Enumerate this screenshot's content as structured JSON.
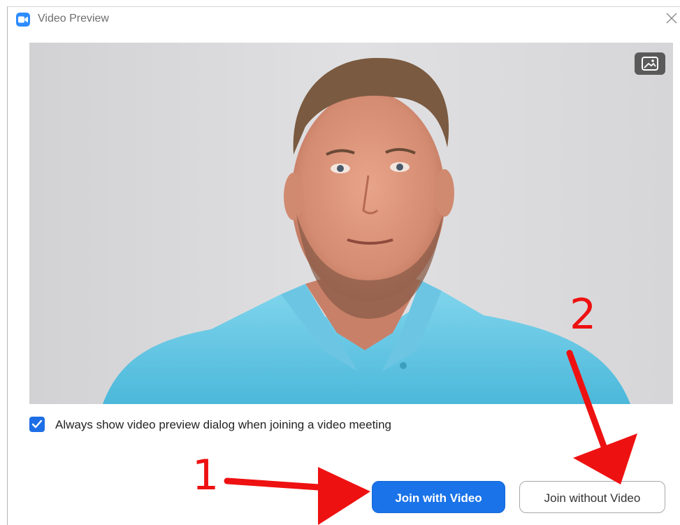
{
  "window": {
    "title": "Video Preview",
    "app_icon": "zoom-camera-icon",
    "close_icon": "close-icon"
  },
  "video": {
    "background_button_icon": "image-icon"
  },
  "options": {
    "always_show_preview": {
      "label": "Always show video preview dialog when joining a video meeting",
      "checked": true
    }
  },
  "buttons": {
    "join_with_video": "Join with Video",
    "join_without_video": "Join without Video"
  },
  "annotations": {
    "step1": "1",
    "step2": "2"
  },
  "colors": {
    "primary": "#1a73e8",
    "annotation": "#ee1111",
    "app_icon": "#2d8cff",
    "shirt": "#5cc8e6"
  }
}
